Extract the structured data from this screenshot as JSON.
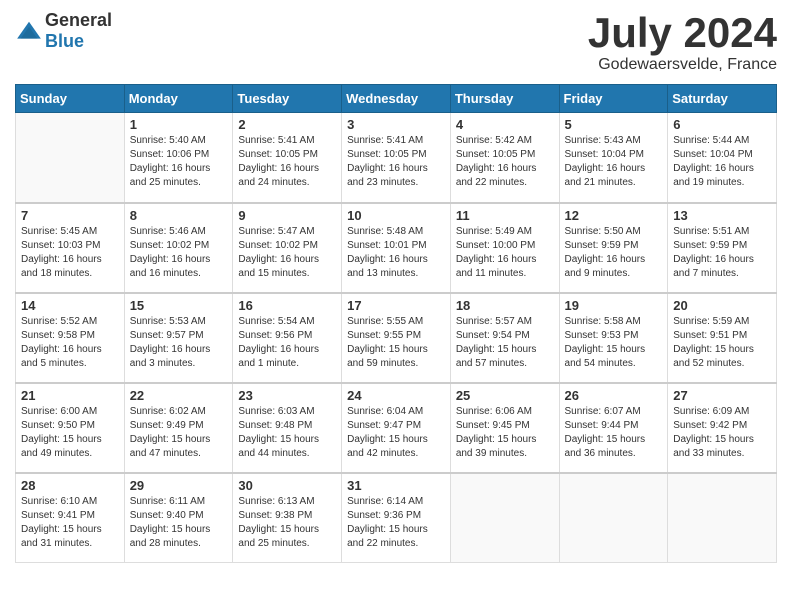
{
  "header": {
    "logo_general": "General",
    "logo_blue": "Blue",
    "month_title": "July 2024",
    "location": "Godewaersvelde, France"
  },
  "weekdays": [
    "Sunday",
    "Monday",
    "Tuesday",
    "Wednesday",
    "Thursday",
    "Friday",
    "Saturday"
  ],
  "weeks": [
    [
      {
        "day": "",
        "info": ""
      },
      {
        "day": "1",
        "info": "Sunrise: 5:40 AM\nSunset: 10:06 PM\nDaylight: 16 hours\nand 25 minutes."
      },
      {
        "day": "2",
        "info": "Sunrise: 5:41 AM\nSunset: 10:05 PM\nDaylight: 16 hours\nand 24 minutes."
      },
      {
        "day": "3",
        "info": "Sunrise: 5:41 AM\nSunset: 10:05 PM\nDaylight: 16 hours\nand 23 minutes."
      },
      {
        "day": "4",
        "info": "Sunrise: 5:42 AM\nSunset: 10:05 PM\nDaylight: 16 hours\nand 22 minutes."
      },
      {
        "day": "5",
        "info": "Sunrise: 5:43 AM\nSunset: 10:04 PM\nDaylight: 16 hours\nand 21 minutes."
      },
      {
        "day": "6",
        "info": "Sunrise: 5:44 AM\nSunset: 10:04 PM\nDaylight: 16 hours\nand 19 minutes."
      }
    ],
    [
      {
        "day": "7",
        "info": "Sunrise: 5:45 AM\nSunset: 10:03 PM\nDaylight: 16 hours\nand 18 minutes."
      },
      {
        "day": "8",
        "info": "Sunrise: 5:46 AM\nSunset: 10:02 PM\nDaylight: 16 hours\nand 16 minutes."
      },
      {
        "day": "9",
        "info": "Sunrise: 5:47 AM\nSunset: 10:02 PM\nDaylight: 16 hours\nand 15 minutes."
      },
      {
        "day": "10",
        "info": "Sunrise: 5:48 AM\nSunset: 10:01 PM\nDaylight: 16 hours\nand 13 minutes."
      },
      {
        "day": "11",
        "info": "Sunrise: 5:49 AM\nSunset: 10:00 PM\nDaylight: 16 hours\nand 11 minutes."
      },
      {
        "day": "12",
        "info": "Sunrise: 5:50 AM\nSunset: 9:59 PM\nDaylight: 16 hours\nand 9 minutes."
      },
      {
        "day": "13",
        "info": "Sunrise: 5:51 AM\nSunset: 9:59 PM\nDaylight: 16 hours\nand 7 minutes."
      }
    ],
    [
      {
        "day": "14",
        "info": "Sunrise: 5:52 AM\nSunset: 9:58 PM\nDaylight: 16 hours\nand 5 minutes."
      },
      {
        "day": "15",
        "info": "Sunrise: 5:53 AM\nSunset: 9:57 PM\nDaylight: 16 hours\nand 3 minutes."
      },
      {
        "day": "16",
        "info": "Sunrise: 5:54 AM\nSunset: 9:56 PM\nDaylight: 16 hours\nand 1 minute."
      },
      {
        "day": "17",
        "info": "Sunrise: 5:55 AM\nSunset: 9:55 PM\nDaylight: 15 hours\nand 59 minutes."
      },
      {
        "day": "18",
        "info": "Sunrise: 5:57 AM\nSunset: 9:54 PM\nDaylight: 15 hours\nand 57 minutes."
      },
      {
        "day": "19",
        "info": "Sunrise: 5:58 AM\nSunset: 9:53 PM\nDaylight: 15 hours\nand 54 minutes."
      },
      {
        "day": "20",
        "info": "Sunrise: 5:59 AM\nSunset: 9:51 PM\nDaylight: 15 hours\nand 52 minutes."
      }
    ],
    [
      {
        "day": "21",
        "info": "Sunrise: 6:00 AM\nSunset: 9:50 PM\nDaylight: 15 hours\nand 49 minutes."
      },
      {
        "day": "22",
        "info": "Sunrise: 6:02 AM\nSunset: 9:49 PM\nDaylight: 15 hours\nand 47 minutes."
      },
      {
        "day": "23",
        "info": "Sunrise: 6:03 AM\nSunset: 9:48 PM\nDaylight: 15 hours\nand 44 minutes."
      },
      {
        "day": "24",
        "info": "Sunrise: 6:04 AM\nSunset: 9:47 PM\nDaylight: 15 hours\nand 42 minutes."
      },
      {
        "day": "25",
        "info": "Sunrise: 6:06 AM\nSunset: 9:45 PM\nDaylight: 15 hours\nand 39 minutes."
      },
      {
        "day": "26",
        "info": "Sunrise: 6:07 AM\nSunset: 9:44 PM\nDaylight: 15 hours\nand 36 minutes."
      },
      {
        "day": "27",
        "info": "Sunrise: 6:09 AM\nSunset: 9:42 PM\nDaylight: 15 hours\nand 33 minutes."
      }
    ],
    [
      {
        "day": "28",
        "info": "Sunrise: 6:10 AM\nSunset: 9:41 PM\nDaylight: 15 hours\nand 31 minutes."
      },
      {
        "day": "29",
        "info": "Sunrise: 6:11 AM\nSunset: 9:40 PM\nDaylight: 15 hours\nand 28 minutes."
      },
      {
        "day": "30",
        "info": "Sunrise: 6:13 AM\nSunset: 9:38 PM\nDaylight: 15 hours\nand 25 minutes."
      },
      {
        "day": "31",
        "info": "Sunrise: 6:14 AM\nSunset: 9:36 PM\nDaylight: 15 hours\nand 22 minutes."
      },
      {
        "day": "",
        "info": ""
      },
      {
        "day": "",
        "info": ""
      },
      {
        "day": "",
        "info": ""
      }
    ]
  ]
}
